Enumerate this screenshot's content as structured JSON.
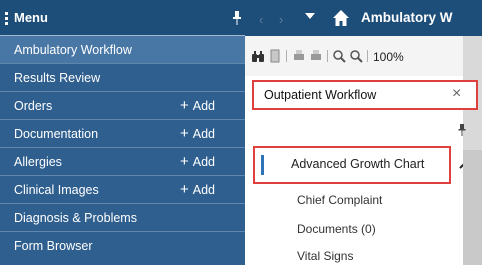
{
  "menu": {
    "title": "Menu",
    "items": [
      {
        "label": "Ambulatory Workflow",
        "active": true
      },
      {
        "label": "Results Review"
      },
      {
        "label": "Orders",
        "add": "Add"
      },
      {
        "label": "Documentation",
        "add": "Add"
      },
      {
        "label": "Allergies",
        "add": "Add"
      },
      {
        "label": "Clinical Images",
        "add": "Add"
      },
      {
        "label": "Diagnosis & Problems"
      },
      {
        "label": "Form Browser"
      }
    ]
  },
  "topbar": {
    "title": "Ambulatory W",
    "back_icon": "chevron-left-icon",
    "forward_icon": "chevron-right-icon",
    "home_icon": "home-icon"
  },
  "toolbar": {
    "zoom": "100%"
  },
  "workflow": {
    "tab_label": "Outpatient Workflow",
    "close_symbol": "×"
  },
  "sections": {
    "active": "Advanced Growth Chart",
    "items": [
      "Chief Complaint",
      "Documents (0)",
      "Vital Signs"
    ]
  },
  "colors": {
    "menu_bg": "#2f5f8f",
    "menu_header_bg": "#1d4d79",
    "highlight_red": "#e0403c",
    "section_accent": "#2e73b8"
  }
}
